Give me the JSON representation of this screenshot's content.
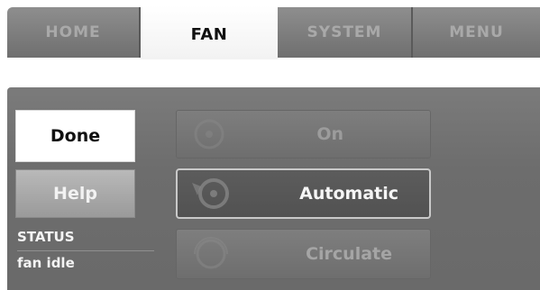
{
  "tabs": [
    {
      "label": "HOME",
      "selected": false
    },
    {
      "label": "FAN",
      "selected": true
    },
    {
      "label": "SYSTEM",
      "selected": false
    },
    {
      "label": "MENU",
      "selected": false
    }
  ],
  "side_buttons": {
    "done_label": "Done",
    "help_label": "Help"
  },
  "status": {
    "label": "STATUS",
    "value": "fan idle"
  },
  "fan_modes": [
    {
      "label": "On",
      "selected": false,
      "icon": "fan-icon"
    },
    {
      "label": "Automatic",
      "selected": true,
      "icon": "fan-icon"
    },
    {
      "label": "Circulate",
      "selected": false,
      "icon": "fan-icon"
    }
  ],
  "colors": {
    "panel": "#6d6d6d",
    "selected_tab": "#ffffff",
    "selected_mode_border": "#c9c9c9"
  }
}
